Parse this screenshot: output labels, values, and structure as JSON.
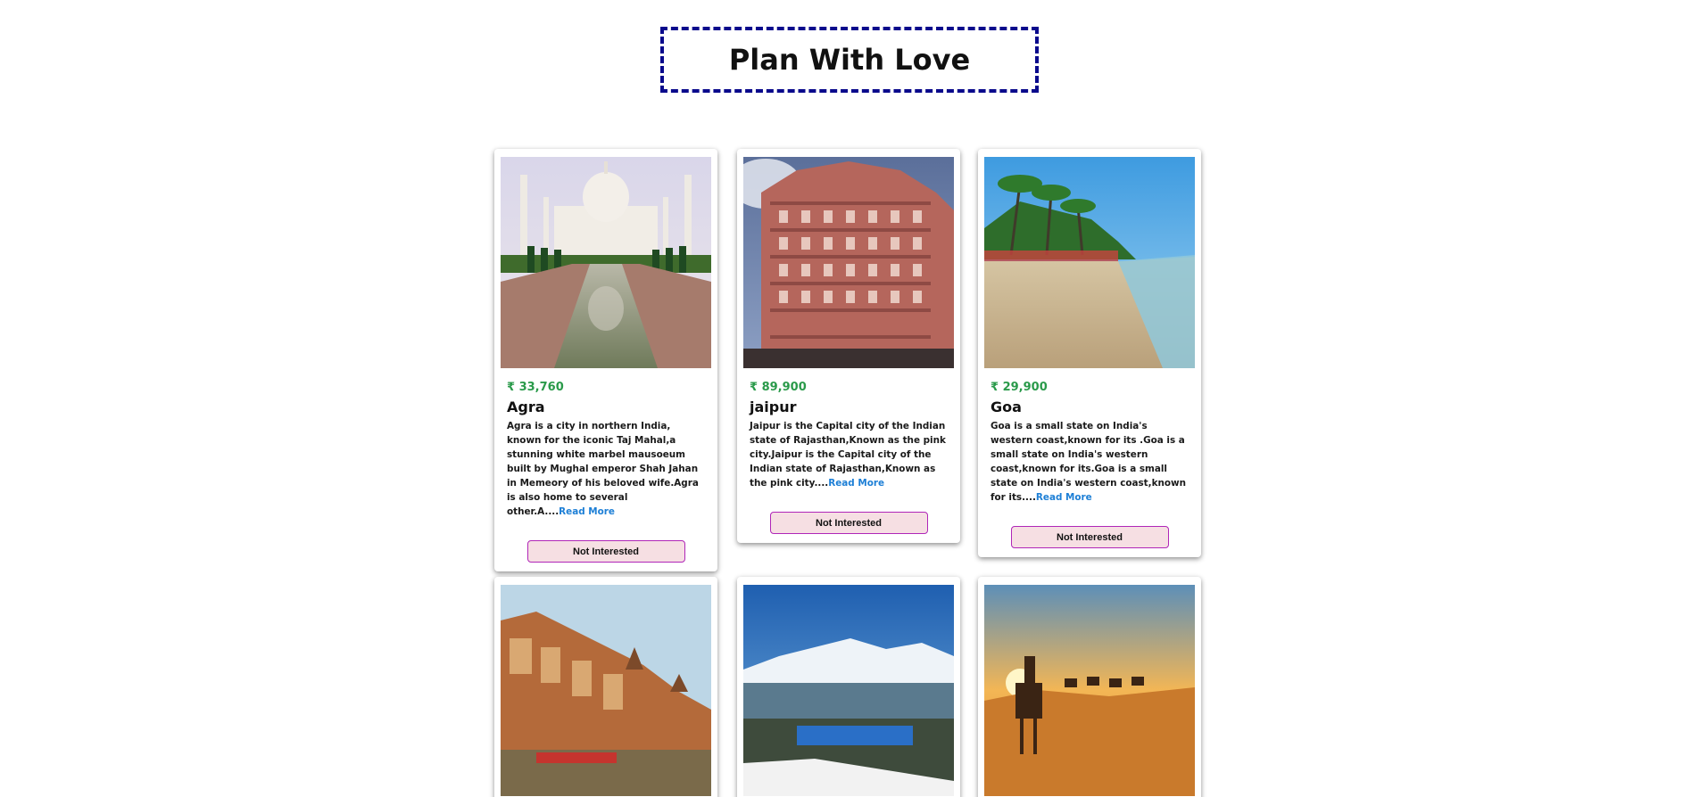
{
  "header": {
    "title": "Plan With Love"
  },
  "cards": [
    {
      "price": "₹ 33,760",
      "name": "Agra",
      "description": "Agra is a city in northern India, known for the iconic Taj Mahal,a stunning white marbel mausoeum built by Mughal emperor Shah Jahan in Memeory of his beloved wife.Agra is also home to several other.A....",
      "read_more": "Read More",
      "button": "Not Interested"
    },
    {
      "price": "₹ 89,900",
      "name": "jaipur",
      "description": "Jaipur is the Capital city of the Indian state of Rajasthan,Known as the pink city.Jaipur is the Capital city of the Indian state of Rajasthan,Known as the pink city....",
      "read_more": "Read More",
      "button": "Not Interested"
    },
    {
      "price": "₹ 29,900",
      "name": "Goa",
      "description": "Goa is a small state on India's western coast,known for its .Goa is a small state on India's western coast,known for its.Goa is a small state on India's western coast,known for its....",
      "read_more": "Read More",
      "button": "Not Interested"
    },
    {
      "image": "varanasi-ghats"
    },
    {
      "image": "darjeeling-hills"
    },
    {
      "image": "desert-camels"
    }
  ]
}
